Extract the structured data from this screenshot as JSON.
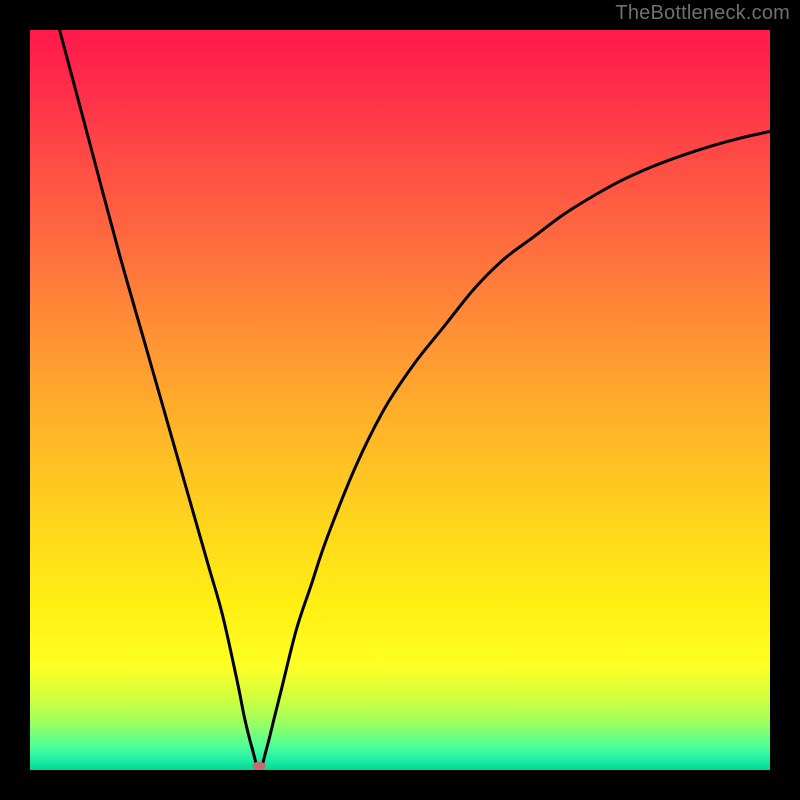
{
  "watermark": "TheBottleneck.com",
  "colors": {
    "background": "#000000",
    "curve": "#000000",
    "bump": "#c86b6b",
    "gradient_top": "#ff1a4b",
    "gradient_bottom": "#00d88f"
  },
  "chart_data": {
    "type": "line",
    "title": "",
    "xlabel": "",
    "ylabel": "",
    "xlim": [
      0,
      100
    ],
    "ylim": [
      0,
      100
    ],
    "notes": "V-shaped bottleneck curve over a vertical rainbow (red→green) gradient. Minimum (optimal point) near x≈31, y≈0. No axis ticks or labels shown.",
    "minimum": {
      "x": 31,
      "y": 0
    },
    "series": [
      {
        "name": "bottleneck-curve",
        "x": [
          4,
          8,
          12,
          16,
          20,
          24,
          26,
          28,
          29,
          30,
          31,
          32,
          33,
          34,
          36,
          38,
          40,
          44,
          48,
          52,
          56,
          60,
          64,
          68,
          72,
          76,
          80,
          84,
          88,
          92,
          96,
          100
        ],
        "values": [
          100,
          85,
          70,
          56,
          42,
          28,
          21,
          12,
          7,
          3,
          0,
          3,
          7,
          11,
          19,
          25,
          31,
          41,
          49,
          55,
          60,
          65,
          69,
          72,
          75,
          77.5,
          79.7,
          81.5,
          83,
          84.3,
          85.4,
          86.3
        ]
      }
    ],
    "markers": [
      {
        "name": "optimal-point",
        "x": 31,
        "y": 0
      }
    ]
  }
}
